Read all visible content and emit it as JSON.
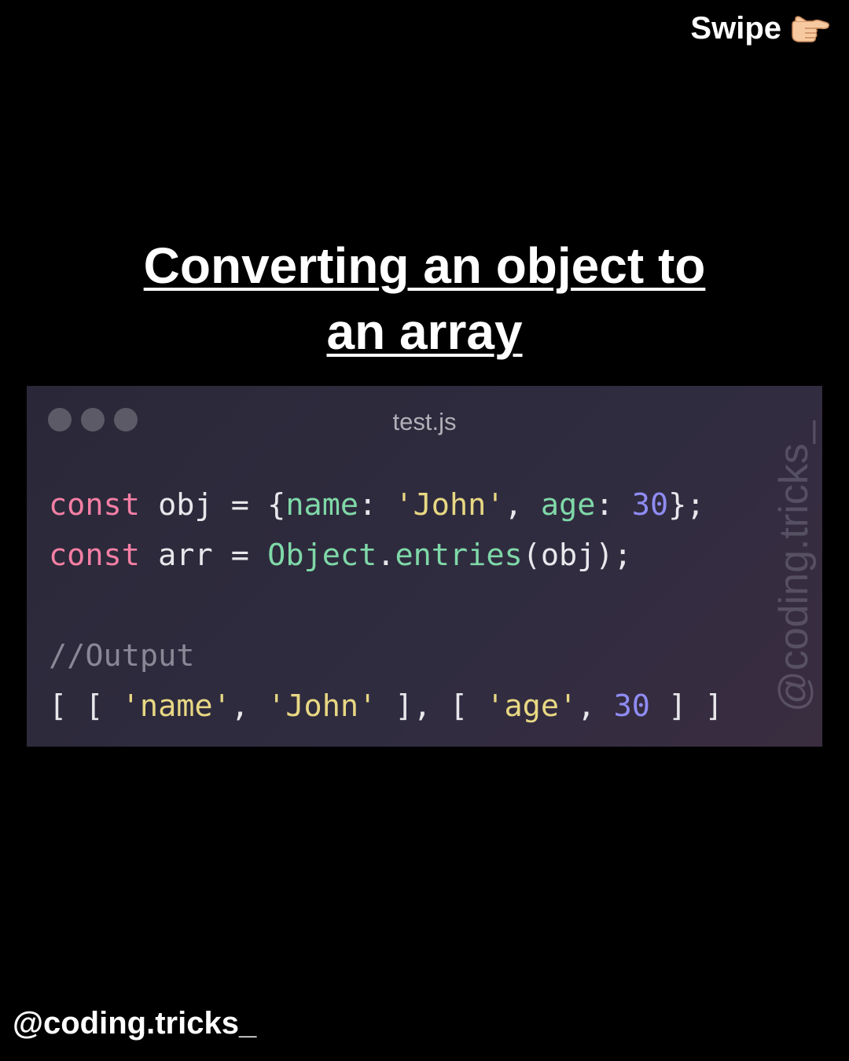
{
  "header": {
    "swipe_label": "Swipe",
    "swipe_icon": "pointing-right-hand-icon"
  },
  "title": {
    "line1": "Converting an object to",
    "line2": "an array"
  },
  "code_window": {
    "filename": "test.js",
    "window_controls": [
      "close-dot",
      "minimize-dot",
      "maximize-dot"
    ],
    "watermark": "@coding.tricks_",
    "lines": [
      [
        {
          "t": "const",
          "c": "kw"
        },
        {
          "t": " obj = {",
          "c": "plain"
        },
        {
          "t": "name",
          "c": "prop"
        },
        {
          "t": ": ",
          "c": "plain"
        },
        {
          "t": "'John'",
          "c": "str"
        },
        {
          "t": ", ",
          "c": "plain"
        },
        {
          "t": "age",
          "c": "prop"
        },
        {
          "t": ": ",
          "c": "plain"
        },
        {
          "t": "30",
          "c": "num"
        },
        {
          "t": "};",
          "c": "plain"
        }
      ],
      [
        {
          "t": "const",
          "c": "kw"
        },
        {
          "t": " arr = ",
          "c": "plain"
        },
        {
          "t": "Object",
          "c": "fn"
        },
        {
          "t": ".",
          "c": "plain"
        },
        {
          "t": "entries",
          "c": "fn"
        },
        {
          "t": "(obj);",
          "c": "plain"
        }
      ],
      [],
      [
        {
          "t": "//Output",
          "c": "comment"
        }
      ],
      [
        {
          "t": "[ [ ",
          "c": "plain"
        },
        {
          "t": "'name'",
          "c": "str"
        },
        {
          "t": ", ",
          "c": "plain"
        },
        {
          "t": "'John'",
          "c": "str"
        },
        {
          "t": " ], [ ",
          "c": "plain"
        },
        {
          "t": "'age'",
          "c": "str"
        },
        {
          "t": ", ",
          "c": "plain"
        },
        {
          "t": "30",
          "c": "num"
        },
        {
          "t": " ] ]",
          "c": "plain"
        }
      ]
    ],
    "colors": {
      "keyword": "#f47fa4",
      "property": "#7fd8a8",
      "string": "#e8d883",
      "number": "#8f8cf4",
      "comment": "#8a8896",
      "plain": "#e8e8ec"
    }
  },
  "footer": {
    "handle": "@coding.tricks_"
  }
}
